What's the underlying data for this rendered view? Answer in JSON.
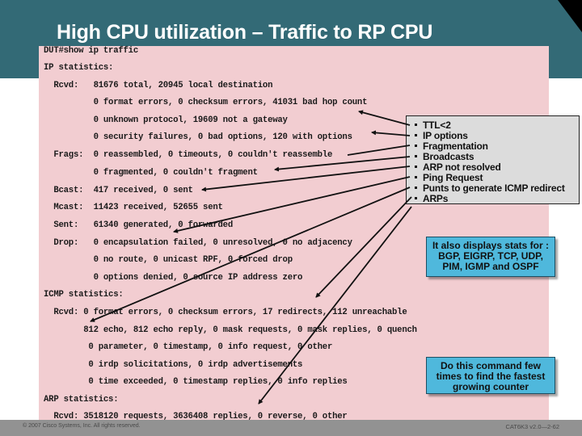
{
  "slide": {
    "title": "High CPU utilization – Traffic to RP CPU"
  },
  "terminal": {
    "lines": [
      "DUT#show ip traffic",
      "IP statistics:",
      "  Rcvd:   81676 total, 20945 local destination",
      "          0 format errors, 0 checksum errors, 41031 bad hop count",
      "          0 unknown protocol, 19609 not a gateway",
      "          0 security failures, 0 bad options, 120 with options",
      "  Frags:  0 reassembled, 0 timeouts, 0 couldn't reassemble",
      "          0 fragmented, 0 couldn't fragment",
      "  Bcast:  417 received, 0 sent",
      "  Mcast:  11423 received, 52655 sent",
      "  Sent:   61340 generated, 0 forwarded",
      "  Drop:   0 encapsulation failed, 0 unresolved, 0 no adjacency",
      "          0 no route, 0 unicast RPF, 0 forced drop",
      "          0 options denied, 0 source IP address zero",
      "ICMP statistics:",
      "  Rcvd: 0 format errors, 0 checksum errors, 17 redirects, 112 unreachable",
      "        812 echo, 812 echo reply, 0 mask requests, 0 mask replies, 0 quench",
      "         0 parameter, 0 timestamp, 0 info request, 0 other",
      "         0 irdp solicitations, 0 irdp advertisements",
      "         0 time exceeded, 0 timestamp replies, 0 info replies",
      "ARP statistics:",
      "  Rcvd: 3518120 requests, 3636408 replies, 0 reverse, 0 other"
    ]
  },
  "callout": {
    "items": [
      "TTL<2",
      "IP options",
      "Fragmentation",
      "Broadcasts",
      "ARP not resolved",
      "Ping Request",
      "Punts to generate ICMP redirect",
      "ARPs"
    ]
  },
  "notes": {
    "stats": [
      "It also displays stats for :",
      "BGP, EIGRP, TCP, UDP,",
      "PIM, IGMP and OSPF"
    ],
    "counter": [
      "Do this command few",
      "times to find the fastest",
      "growing counter"
    ]
  },
  "footer": {
    "copyright": "© 2007 Cisco Systems, Inc. All rights reserved.",
    "slide_code": "CAT6K3 v2.0—2-62"
  },
  "colors": {
    "header": "#336a76",
    "terminal_bg": "#f2cdd1",
    "callout_bg": "#dcdcdc",
    "note_bg": "#4fb8dc",
    "footer": "#929292"
  }
}
